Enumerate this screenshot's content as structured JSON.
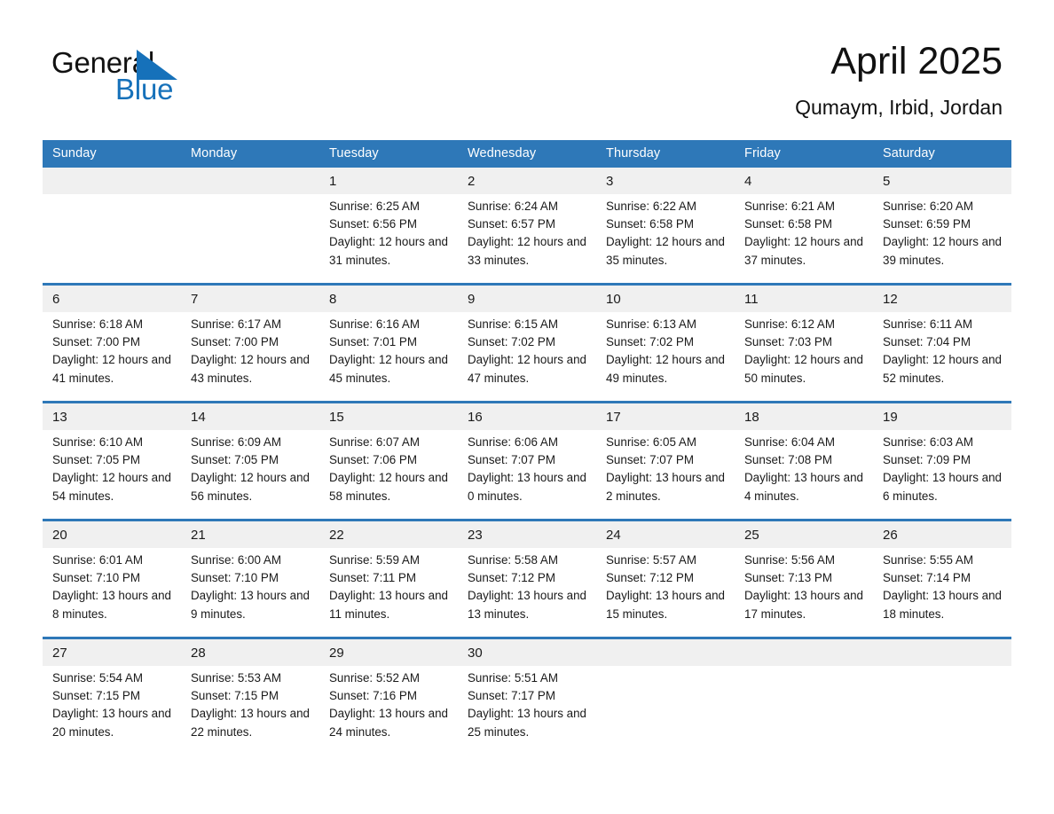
{
  "brand": {
    "name_part1": "General",
    "name_part2": "Blue",
    "accent_color": "#1671BA",
    "triangle_icon": "triangle-icon"
  },
  "header": {
    "title": "April 2025",
    "location": "Qumaym, Irbid, Jordan"
  },
  "theme": {
    "header_blue": "#2E78B8",
    "daynum_band": "#F0F0F0",
    "text": "#1a1a1a"
  },
  "calendar": {
    "weekday_headers": [
      "Sunday",
      "Monday",
      "Tuesday",
      "Wednesday",
      "Thursday",
      "Friday",
      "Saturday"
    ],
    "labels": {
      "sunrise_prefix": "Sunrise:",
      "sunset_prefix": "Sunset:",
      "daylight_prefix": "Daylight:"
    },
    "weeks": [
      [
        {
          "day": "",
          "sunrise": "",
          "sunset": "",
          "daylight": ""
        },
        {
          "day": "",
          "sunrise": "",
          "sunset": "",
          "daylight": ""
        },
        {
          "day": "1",
          "sunrise": "Sunrise: 6:25 AM",
          "sunset": "Sunset: 6:56 PM",
          "daylight": "Daylight: 12 hours and 31 minutes."
        },
        {
          "day": "2",
          "sunrise": "Sunrise: 6:24 AM",
          "sunset": "Sunset: 6:57 PM",
          "daylight": "Daylight: 12 hours and 33 minutes."
        },
        {
          "day": "3",
          "sunrise": "Sunrise: 6:22 AM",
          "sunset": "Sunset: 6:58 PM",
          "daylight": "Daylight: 12 hours and 35 minutes."
        },
        {
          "day": "4",
          "sunrise": "Sunrise: 6:21 AM",
          "sunset": "Sunset: 6:58 PM",
          "daylight": "Daylight: 12 hours and 37 minutes."
        },
        {
          "day": "5",
          "sunrise": "Sunrise: 6:20 AM",
          "sunset": "Sunset: 6:59 PM",
          "daylight": "Daylight: 12 hours and 39 minutes."
        }
      ],
      [
        {
          "day": "6",
          "sunrise": "Sunrise: 6:18 AM",
          "sunset": "Sunset: 7:00 PM",
          "daylight": "Daylight: 12 hours and 41 minutes."
        },
        {
          "day": "7",
          "sunrise": "Sunrise: 6:17 AM",
          "sunset": "Sunset: 7:00 PM",
          "daylight": "Daylight: 12 hours and 43 minutes."
        },
        {
          "day": "8",
          "sunrise": "Sunrise: 6:16 AM",
          "sunset": "Sunset: 7:01 PM",
          "daylight": "Daylight: 12 hours and 45 minutes."
        },
        {
          "day": "9",
          "sunrise": "Sunrise: 6:15 AM",
          "sunset": "Sunset: 7:02 PM",
          "daylight": "Daylight: 12 hours and 47 minutes."
        },
        {
          "day": "10",
          "sunrise": "Sunrise: 6:13 AM",
          "sunset": "Sunset: 7:02 PM",
          "daylight": "Daylight: 12 hours and 49 minutes."
        },
        {
          "day": "11",
          "sunrise": "Sunrise: 6:12 AM",
          "sunset": "Sunset: 7:03 PM",
          "daylight": "Daylight: 12 hours and 50 minutes."
        },
        {
          "day": "12",
          "sunrise": "Sunrise: 6:11 AM",
          "sunset": "Sunset: 7:04 PM",
          "daylight": "Daylight: 12 hours and 52 minutes."
        }
      ],
      [
        {
          "day": "13",
          "sunrise": "Sunrise: 6:10 AM",
          "sunset": "Sunset: 7:05 PM",
          "daylight": "Daylight: 12 hours and 54 minutes."
        },
        {
          "day": "14",
          "sunrise": "Sunrise: 6:09 AM",
          "sunset": "Sunset: 7:05 PM",
          "daylight": "Daylight: 12 hours and 56 minutes."
        },
        {
          "day": "15",
          "sunrise": "Sunrise: 6:07 AM",
          "sunset": "Sunset: 7:06 PM",
          "daylight": "Daylight: 12 hours and 58 minutes."
        },
        {
          "day": "16",
          "sunrise": "Sunrise: 6:06 AM",
          "sunset": "Sunset: 7:07 PM",
          "daylight": "Daylight: 13 hours and 0 minutes."
        },
        {
          "day": "17",
          "sunrise": "Sunrise: 6:05 AM",
          "sunset": "Sunset: 7:07 PM",
          "daylight": "Daylight: 13 hours and 2 minutes."
        },
        {
          "day": "18",
          "sunrise": "Sunrise: 6:04 AM",
          "sunset": "Sunset: 7:08 PM",
          "daylight": "Daylight: 13 hours and 4 minutes."
        },
        {
          "day": "19",
          "sunrise": "Sunrise: 6:03 AM",
          "sunset": "Sunset: 7:09 PM",
          "daylight": "Daylight: 13 hours and 6 minutes."
        }
      ],
      [
        {
          "day": "20",
          "sunrise": "Sunrise: 6:01 AM",
          "sunset": "Sunset: 7:10 PM",
          "daylight": "Daylight: 13 hours and 8 minutes."
        },
        {
          "day": "21",
          "sunrise": "Sunrise: 6:00 AM",
          "sunset": "Sunset: 7:10 PM",
          "daylight": "Daylight: 13 hours and 9 minutes."
        },
        {
          "day": "22",
          "sunrise": "Sunrise: 5:59 AM",
          "sunset": "Sunset: 7:11 PM",
          "daylight": "Daylight: 13 hours and 11 minutes."
        },
        {
          "day": "23",
          "sunrise": "Sunrise: 5:58 AM",
          "sunset": "Sunset: 7:12 PM",
          "daylight": "Daylight: 13 hours and 13 minutes."
        },
        {
          "day": "24",
          "sunrise": "Sunrise: 5:57 AM",
          "sunset": "Sunset: 7:12 PM",
          "daylight": "Daylight: 13 hours and 15 minutes."
        },
        {
          "day": "25",
          "sunrise": "Sunrise: 5:56 AM",
          "sunset": "Sunset: 7:13 PM",
          "daylight": "Daylight: 13 hours and 17 minutes."
        },
        {
          "day": "26",
          "sunrise": "Sunrise: 5:55 AM",
          "sunset": "Sunset: 7:14 PM",
          "daylight": "Daylight: 13 hours and 18 minutes."
        }
      ],
      [
        {
          "day": "27",
          "sunrise": "Sunrise: 5:54 AM",
          "sunset": "Sunset: 7:15 PM",
          "daylight": "Daylight: 13 hours and 20 minutes."
        },
        {
          "day": "28",
          "sunrise": "Sunrise: 5:53 AM",
          "sunset": "Sunset: 7:15 PM",
          "daylight": "Daylight: 13 hours and 22 minutes."
        },
        {
          "day": "29",
          "sunrise": "Sunrise: 5:52 AM",
          "sunset": "Sunset: 7:16 PM",
          "daylight": "Daylight: 13 hours and 24 minutes."
        },
        {
          "day": "30",
          "sunrise": "Sunrise: 5:51 AM",
          "sunset": "Sunset: 7:17 PM",
          "daylight": "Daylight: 13 hours and 25 minutes."
        },
        {
          "day": "",
          "sunrise": "",
          "sunset": "",
          "daylight": ""
        },
        {
          "day": "",
          "sunrise": "",
          "sunset": "",
          "daylight": ""
        },
        {
          "day": "",
          "sunrise": "",
          "sunset": "",
          "daylight": ""
        }
      ]
    ]
  }
}
